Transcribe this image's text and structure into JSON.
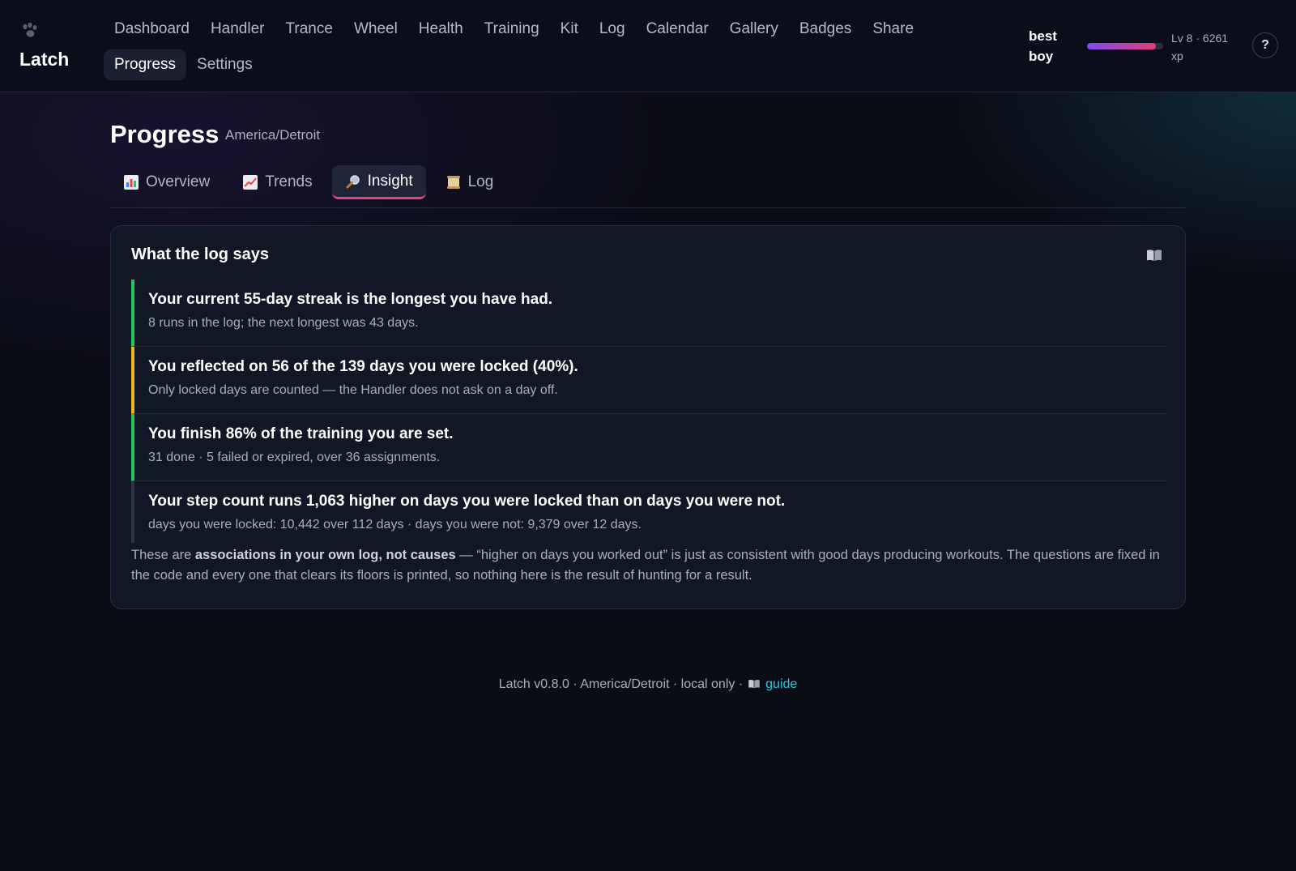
{
  "app": {
    "name": "Latch"
  },
  "nav": {
    "row1": [
      "Dashboard",
      "Handler",
      "Trance",
      "Wheel",
      "Health",
      "Training",
      "Kit",
      "Log",
      "Calendar",
      "Gallery",
      "Badges",
      "Share"
    ],
    "row2": [
      "Progress",
      "Settings"
    ],
    "active": "Progress"
  },
  "user": {
    "name": "best boy",
    "level_text": "Lv 8 · 6261 xp",
    "xp_progress": 0.9
  },
  "help": {
    "label": "?"
  },
  "page": {
    "title": "Progress",
    "timezone": "America/Detroit"
  },
  "tabs": [
    {
      "label": "Overview",
      "icon": "bar-chart-icon",
      "active": false
    },
    {
      "label": "Trends",
      "icon": "trend-chart-icon",
      "active": false
    },
    {
      "label": "Insight",
      "icon": "magnifier-icon",
      "active": true
    },
    {
      "label": "Log",
      "icon": "scroll-icon",
      "active": false
    }
  ],
  "card": {
    "title": "What the log says",
    "insights": [
      {
        "head": "Your current 55-day streak is the longest you have had.",
        "sub": "8 runs in the log; the next longest was 43 days.",
        "tone": "green"
      },
      {
        "head": "You reflected on 56 of the 139 days you were locked (40%).",
        "sub": "Only locked days are counted — the Handler does not ask on a day off.",
        "tone": "amber"
      },
      {
        "head": "You finish 86% of the training you are set.",
        "sub": "31 done · 5 failed or expired, over 36 assignments.",
        "tone": "green"
      },
      {
        "head": "Your step count runs 1,063 higher on days you were locked than on days you were not.",
        "sub": "days you were locked: 10,442 over 112 days · days you were not: 9,379 over 12 days.",
        "tone": "neutral"
      }
    ],
    "note": {
      "pre": "These are ",
      "bold": "associations in your own log, not causes",
      "post": " — “higher on days you worked out” is just as consistent with good days producing workouts. The questions are fixed in the code and every one that clears its floors is printed, so nothing here is the result of hunting for a result."
    }
  },
  "footer": {
    "text": "Latch v0.8.0 · America/Detroit · local only ·",
    "link": "guide"
  },
  "colors": {
    "accent_pink": "#e8437f",
    "green": "#22c55e",
    "amber": "#f3b21f",
    "link": "#2cc8e0"
  }
}
